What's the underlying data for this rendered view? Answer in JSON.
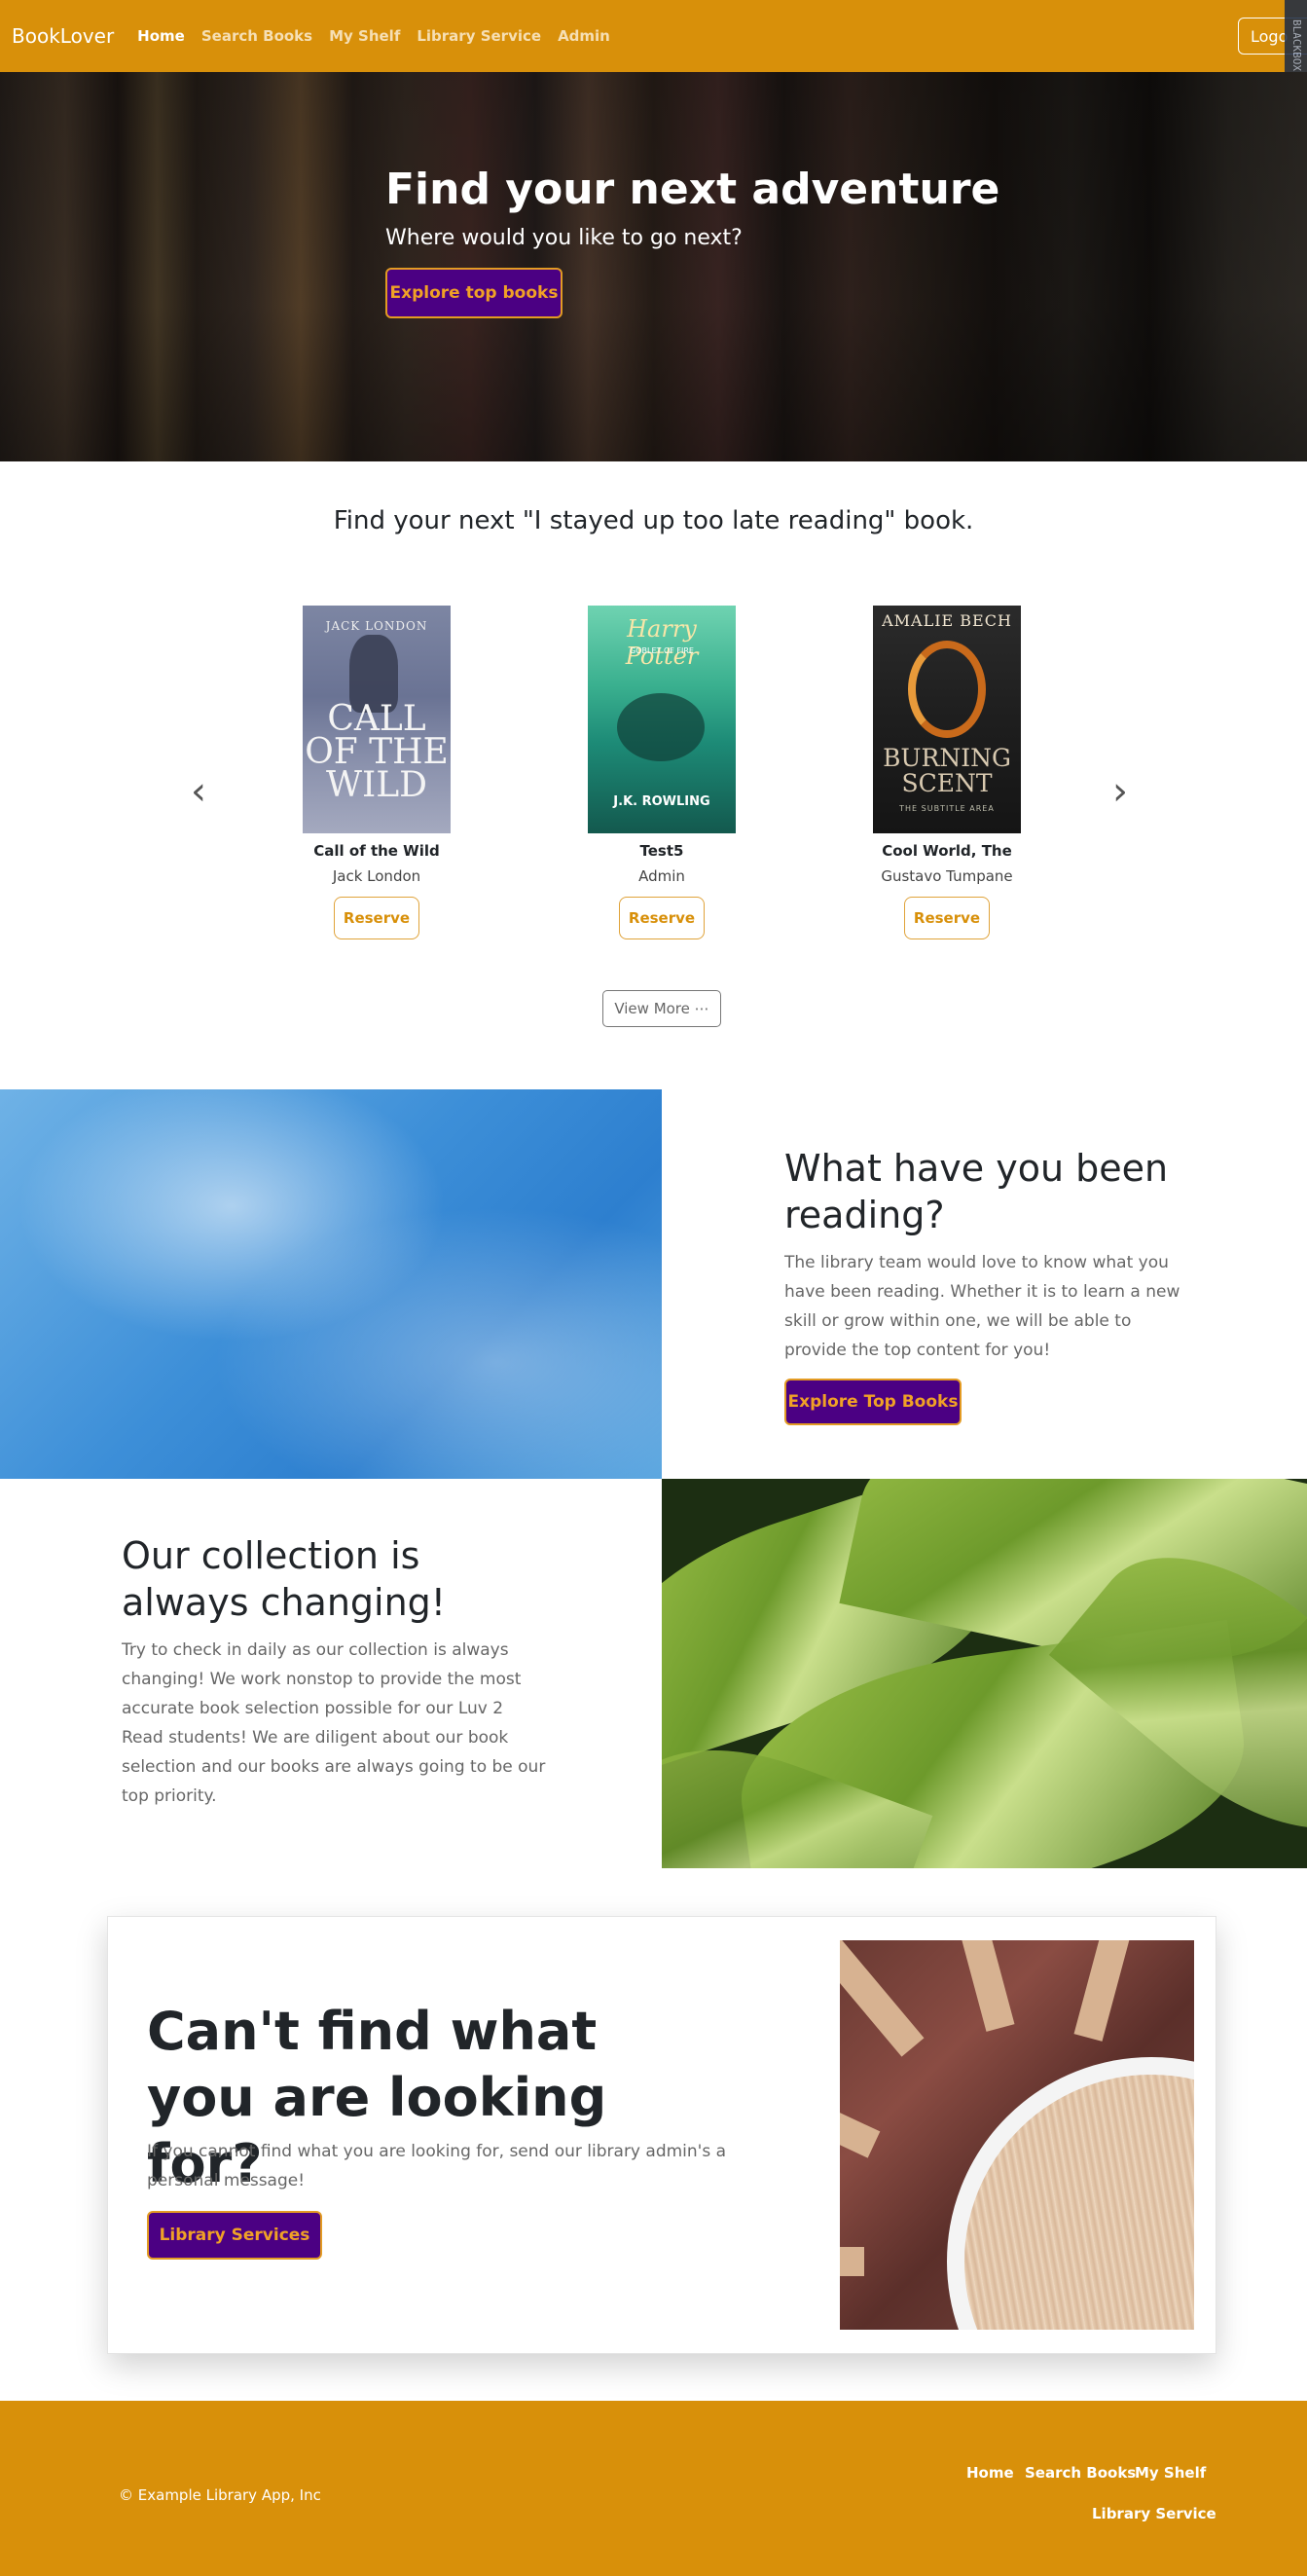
{
  "navbar": {
    "brand": "BookLover",
    "links": [
      "Home",
      "Search Books",
      "My Shelf",
      "Library Service",
      "Admin"
    ],
    "active": "Home",
    "logout_label": "Logo"
  },
  "hero": {
    "title": "Find your next adventure",
    "subtitle": "Where would you like to go next?",
    "button_label": "Explore top books"
  },
  "carousel": {
    "heading": "Find your next \"I stayed up too late reading\" book.",
    "prev_icon": "chevron-left-icon",
    "next_icon": "chevron-right-icon",
    "books": [
      {
        "title": "Call of the Wild",
        "author": "Jack London",
        "button": "Reserve",
        "cover_author": "JACK LONDON",
        "cover_title": "CALL OF THE WILD"
      },
      {
        "title": "Test5",
        "author": "Admin",
        "button": "Reserve",
        "cover_title": "Harry Potter",
        "cover_sub": "GOBLET OF FIRE",
        "cover_author": "J.K. ROWLING"
      },
      {
        "title": "Cool World, The",
        "author": "Gustavo Tumpane",
        "button": "Reserve",
        "cover_author": "AMALIE BECH",
        "cover_title": "BURNING SCENT",
        "cover_sub": "THE SUBTITLE AREA"
      }
    ],
    "view_more": "View More ⋯"
  },
  "reading": {
    "title": "What have you been reading?",
    "text": "The library team would love to know what you have been reading. Whether it is to learn a new skill or grow within one, we will be able to provide the top content for you!",
    "button_label": "Explore Top Books"
  },
  "collection": {
    "title": "Our collection is always changing!",
    "text": "Try to check in daily as our collection is always changing! We work nonstop to provide the most accurate book selection possible for our Luv 2 Read students! We are diligent about our book selection and our books are always going to be our top priority."
  },
  "cta": {
    "title": "Can't find what you are looking for?",
    "text": "If you cannot find what you are looking for, send our library admin's a personal message!",
    "button_label": "Library Services"
  },
  "footer": {
    "copyright": "© Example Library App, Inc",
    "links": [
      "Home",
      "Search Books",
      "My Shelf",
      "Library Service"
    ]
  },
  "side_tab_label": "BLACKBOX AI",
  "colors": {
    "primary": "#d8900a",
    "button_bg": "#4b0083",
    "button_text": "#f0a126"
  }
}
